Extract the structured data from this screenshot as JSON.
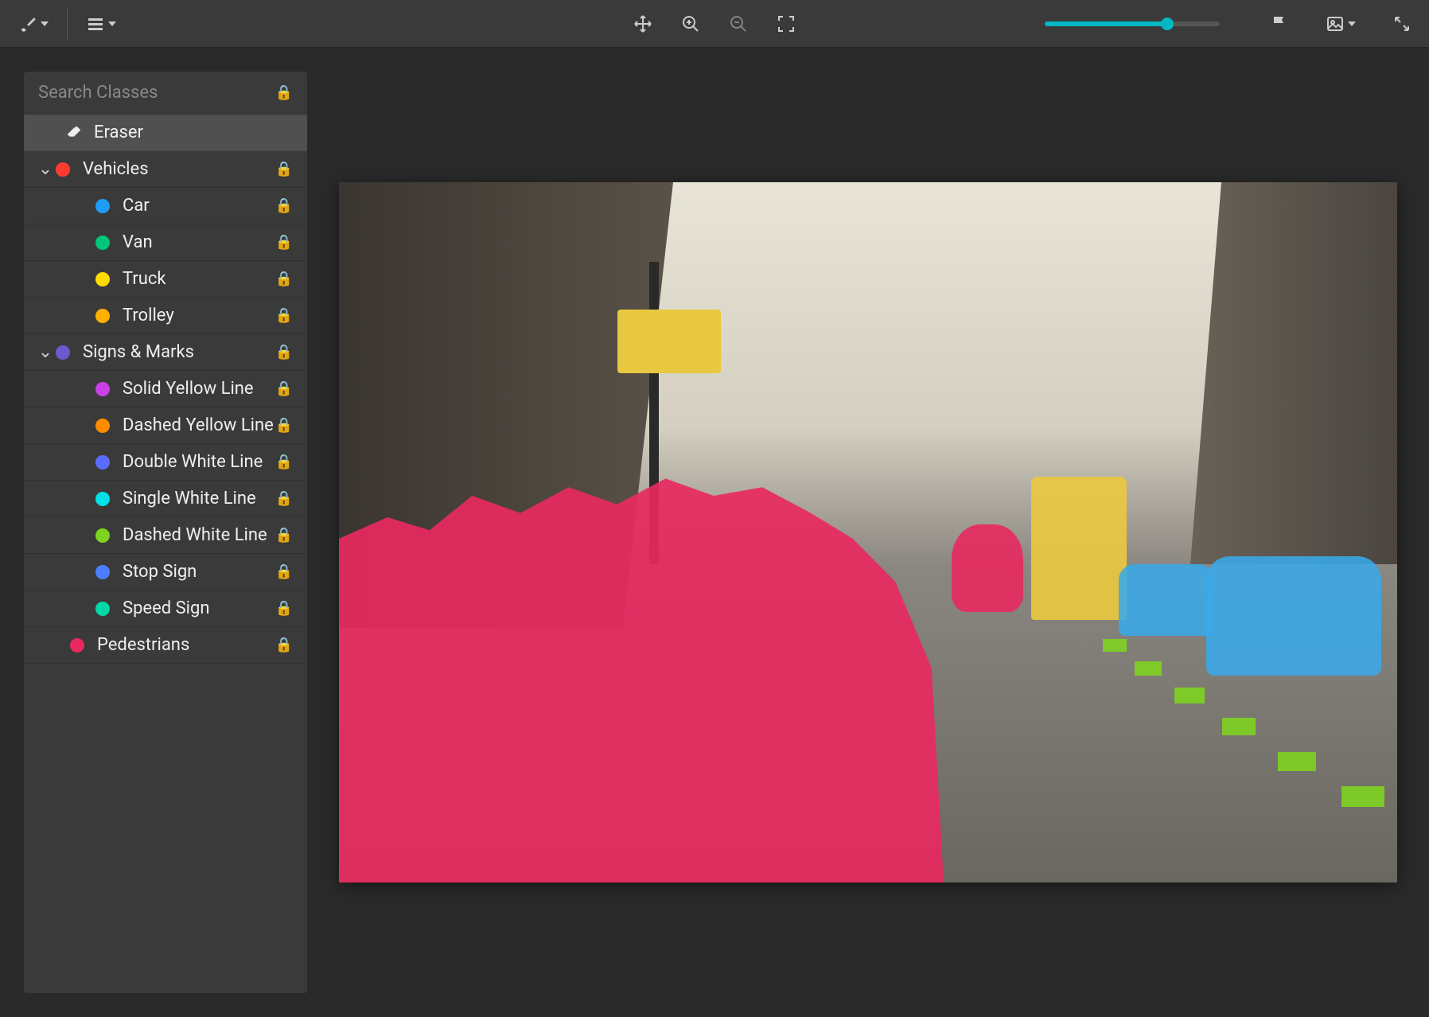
{
  "toolbar": {
    "brush_tool": "brush",
    "menu_tool": "menu"
  },
  "sidebar": {
    "search_placeholder": "Search Classes",
    "eraser_label": "Eraser",
    "groups": [
      {
        "label": "Vehicles",
        "color": "#ff3b30",
        "children": [
          {
            "label": "Car",
            "color": "#1e9df7"
          },
          {
            "label": "Van",
            "color": "#00c77a"
          },
          {
            "label": "Truck",
            "color": "#ffdb00"
          },
          {
            "label": "Trolley",
            "color": "#ffb000"
          }
        ]
      },
      {
        "label": "Signs & Marks",
        "color": "#6a5acd",
        "children": [
          {
            "label": "Solid Yellow Line",
            "color": "#c840e8"
          },
          {
            "label": "Dashed Yellow Line",
            "color": "#ff8c00"
          },
          {
            "label": "Double White Line",
            "color": "#5a6cff"
          },
          {
            "label": "Single White Line",
            "color": "#00e0e8"
          },
          {
            "label": "Dashed White Line",
            "color": "#7ed321"
          },
          {
            "label": "Stop Sign",
            "color": "#4a7eff"
          },
          {
            "label": "Speed Sign",
            "color": "#00d8a8"
          }
        ]
      }
    ],
    "top_items": [
      {
        "label": "Pedestrians",
        "color": "#e8295f"
      }
    ]
  },
  "slider": {
    "value": 70
  }
}
